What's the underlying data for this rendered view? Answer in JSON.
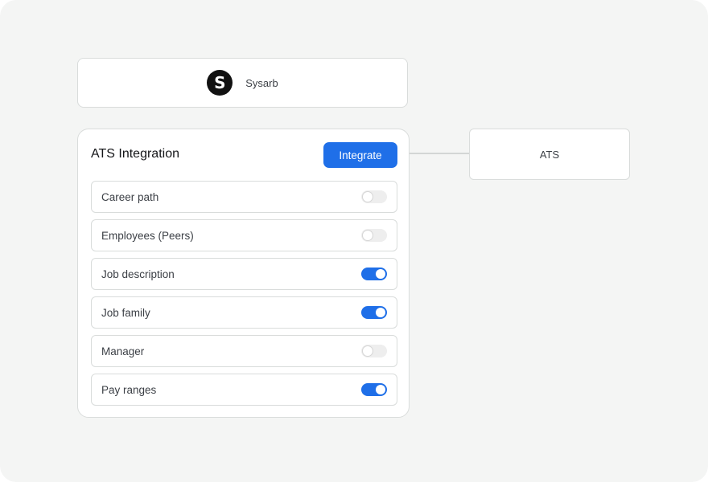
{
  "company": {
    "logo_letter": "S",
    "name": "Sysarb"
  },
  "integration": {
    "title": "ATS Integration",
    "button_label": "Integrate",
    "fields": [
      {
        "label": "Career path",
        "enabled": false
      },
      {
        "label": "Employees (Peers)",
        "enabled": false
      },
      {
        "label": "Job description",
        "enabled": true
      },
      {
        "label": "Job family",
        "enabled": true
      },
      {
        "label": "Manager",
        "enabled": false
      },
      {
        "label": "Pay ranges",
        "enabled": true
      }
    ]
  },
  "target": {
    "label": "ATS"
  },
  "colors": {
    "accent": "#1f6fe8",
    "background": "#f4f5f4",
    "border": "#d9dcdb"
  }
}
